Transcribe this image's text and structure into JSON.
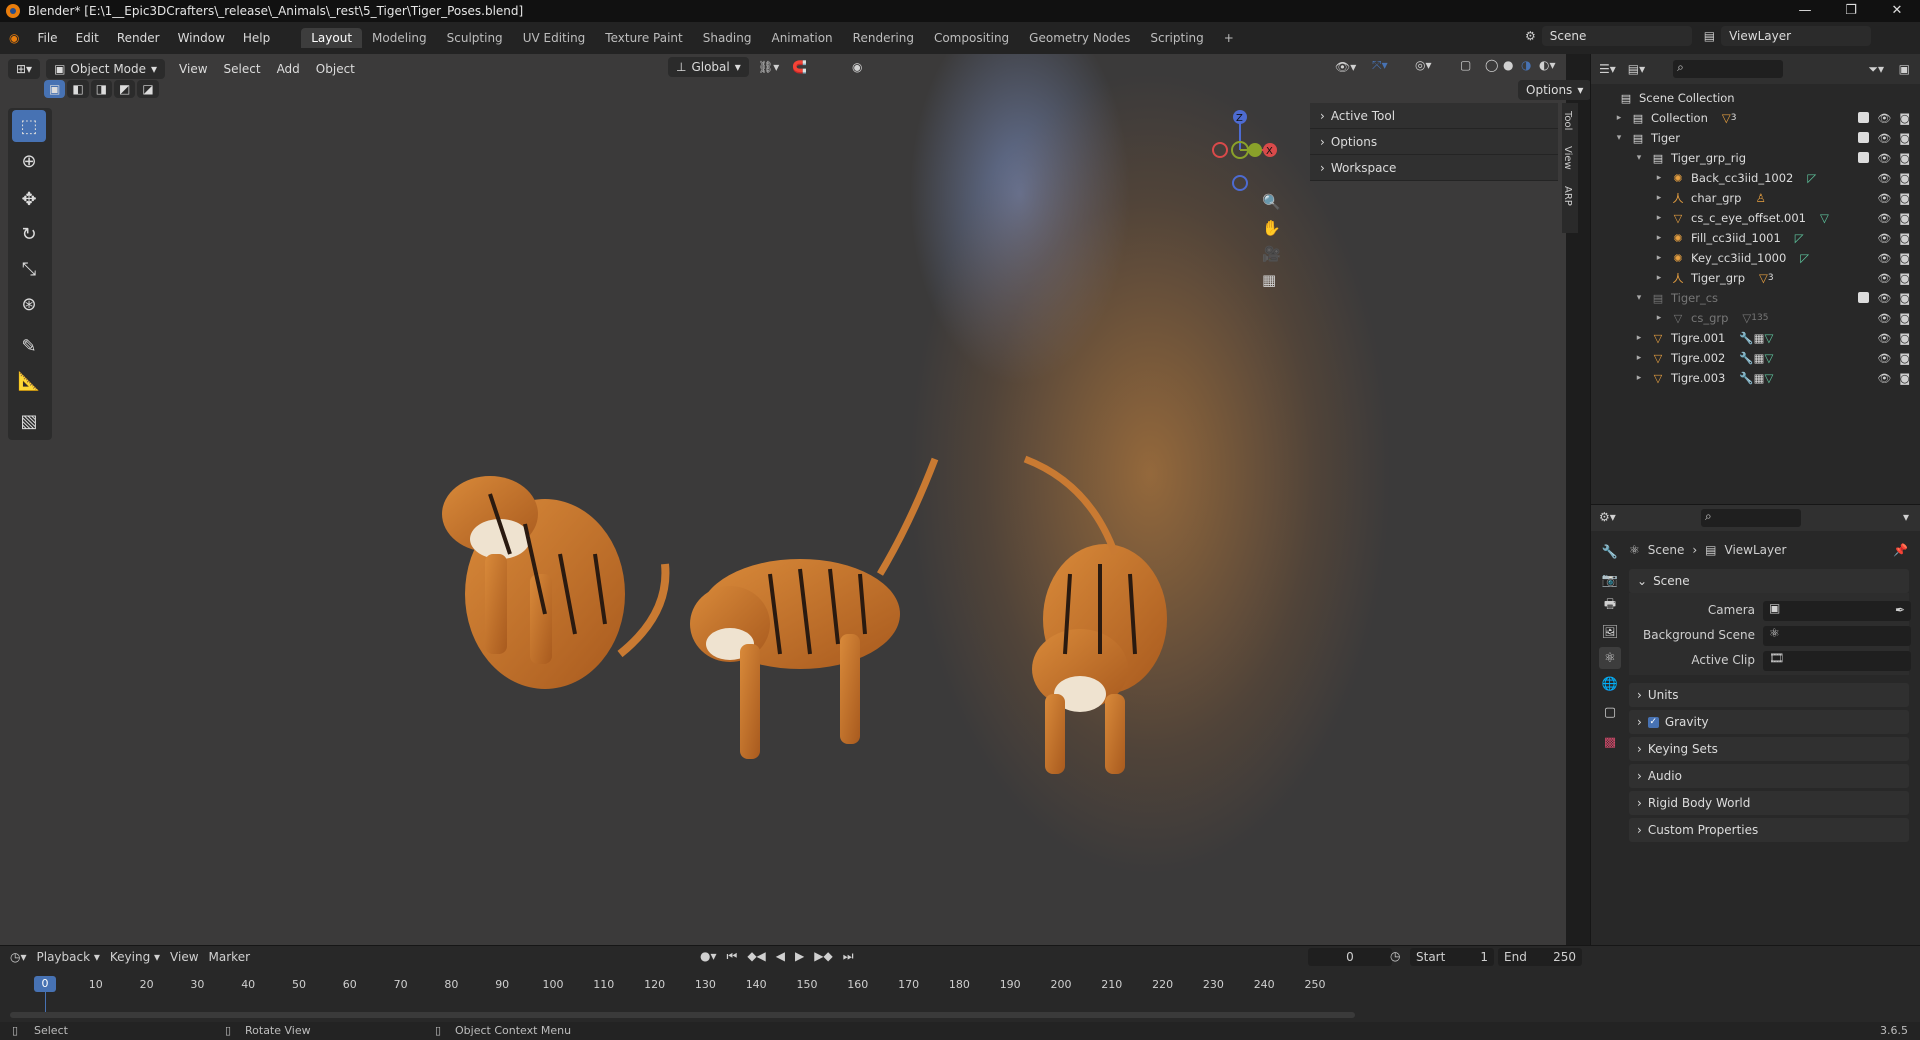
{
  "titlebar": {
    "title": "Blender* [E:\\1__Epic3DCrafters\\_release\\_Animals\\_rest\\5_Tiger\\Tiger_Poses.blend]"
  },
  "menubar": {
    "items": [
      "File",
      "Edit",
      "Render",
      "Window",
      "Help"
    ],
    "workspaces": [
      "Layout",
      "Modeling",
      "Sculpting",
      "UV Editing",
      "Texture Paint",
      "Shading",
      "Animation",
      "Rendering",
      "Compositing",
      "Geometry Nodes",
      "Scripting",
      "+"
    ],
    "scene_label": "Scene",
    "viewlayer_label": "ViewLayer"
  },
  "viewport_header": {
    "mode": "Object Mode",
    "menus": [
      "View",
      "Select",
      "Add",
      "Object"
    ],
    "orientation": "Global",
    "options_label": "Options"
  },
  "npanel": {
    "rows": [
      "Active Tool",
      "Options",
      "Workspace"
    ],
    "tabs": [
      "Tool",
      "View",
      "ARP"
    ]
  },
  "outliner": {
    "root": "Scene Collection",
    "rows": [
      {
        "name": "Collection",
        "badge": "3"
      },
      {
        "name": "Tiger",
        "badge": ""
      },
      {
        "name": "Tiger_grp_rig",
        "badge": ""
      },
      {
        "name": "Back_cc3iid_1002",
        "badge": ""
      },
      {
        "name": "char_grp",
        "badge": ""
      },
      {
        "name": "cs_c_eye_offset.001",
        "badge": ""
      },
      {
        "name": "Fill_cc3iid_1001",
        "badge": ""
      },
      {
        "name": "Key_cc3iid_1000",
        "badge": ""
      },
      {
        "name": "Tiger_grp",
        "badge": "3"
      },
      {
        "name": "Tiger_cs",
        "badge": ""
      },
      {
        "name": "cs_grp",
        "badge": "135"
      },
      {
        "name": "Tigre.001",
        "badge": ""
      },
      {
        "name": "Tigre.002",
        "badge": ""
      },
      {
        "name": "Tigre.003",
        "badge": ""
      }
    ]
  },
  "properties": {
    "breadcrumb": {
      "scene": "Scene",
      "viewlayer": "ViewLayer"
    },
    "section": "Scene",
    "fields": [
      "Camera",
      "Background Scene",
      "Active Clip"
    ],
    "subsections": [
      "Units",
      "Gravity",
      "Keying Sets",
      "Audio",
      "Rigid Body World",
      "Custom Properties"
    ]
  },
  "timeline": {
    "menus": [
      "Playback",
      "Keying",
      "View",
      "Marker"
    ],
    "current_frame": "0",
    "start_label": "Start",
    "start": "1",
    "end_label": "End",
    "end": "250",
    "ticks": [
      "0",
      "10",
      "20",
      "30",
      "40",
      "50",
      "60",
      "70",
      "80",
      "90",
      "100",
      "110",
      "120",
      "130",
      "140",
      "150",
      "160",
      "170",
      "180",
      "190",
      "200",
      "210",
      "220",
      "230",
      "240",
      "250"
    ]
  },
  "statusbar": {
    "select": "Select",
    "rotate": "Rotate View",
    "context": "Object Context Menu",
    "version": "3.6.5"
  },
  "colors": {
    "accent": "#4772b3",
    "orange": "#e87d0d",
    "bg": "#3b3a3a"
  }
}
